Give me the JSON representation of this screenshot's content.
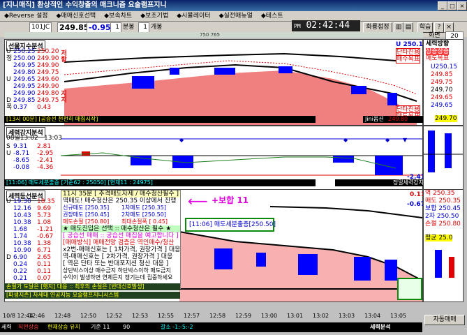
{
  "window": {
    "title": "[지니매직] 환상적인 수익창출의 매크니즘 요술램프지니"
  },
  "menu": [
    "◆Reverse 설정",
    "◆매매신호선택",
    "◆보속차트",
    "◆보조기법",
    "◆시뮬레이터",
    "◆실전매뉴얼",
    "◆테스트"
  ],
  "toolbar": {
    "code": "101JC",
    "price": "249.85",
    "change": "-0.95",
    "period": "1",
    "period_unit": "분봉",
    "count": "1",
    "count_unit": "개봉",
    "clock_prefix": "PM",
    "clock": "02:42:44",
    "right_btn1": "화룡점정",
    "right_btn2": "학습",
    "right_btn3": "?",
    "screen_label": "화면",
    "screen_no": "20",
    "num_label": "750 765"
  },
  "panel1": {
    "title": "선물지수분석",
    "rows": [
      {
        "k": "U",
        "a": "250.25",
        "b": "250.20"
      },
      {
        "k": "정",
        "a": "250.00",
        "b": "249.90"
      },
      {
        "k": "",
        "a": "249.95",
        "b": "249.90"
      },
      {
        "k": "",
        "a": "249.80",
        "b": "249.75"
      },
      {
        "k": "U",
        "a": "249.65",
        "b": "249.60"
      },
      {
        "k": "",
        "a": "249.95",
        "b": "249.90"
      },
      {
        "k": "",
        "a": "249.90",
        "b": "249.80"
      },
      {
        "k": "D",
        "a": "249.85",
        "b": "249.75"
      },
      {
        "k": "폭",
        "a": "0.37",
        "b": "0.43"
      }
    ],
    "side_label1": "저항",
    "side_label2": "지지",
    "footer": "[13시 00분] [공습선 천천히 매집시작]",
    "footer_right": "Jini옵션",
    "footer_price": "249.80",
    "tag1": "단타진용",
    "tag2": "매도목표"
  },
  "right1": {
    "title": "세력방향",
    "sub": "상승상승",
    "tag": "매도목표",
    "labels": [
      "U250.15",
      "249.85",
      "249.75",
      "249.70",
      "249.65",
      "249.65"
    ],
    "price": "249.70",
    "top_price": "U 250.15",
    "top_tag1": "단타진용",
    "top_tag2": "매수목표"
  },
  "panel2": {
    "title": "세력강지분석",
    "time": "08일13:02",
    "time2": "13:03",
    "rows": [
      {
        "k": "S",
        "a": "9.31",
        "b": "2.81"
      },
      {
        "k": "U",
        "a": "-8.71",
        "b": "-2.95"
      },
      {
        "k": "",
        "a": "-8.65",
        "b": "-2.41"
      },
      {
        "k": "",
        "a": "-0.08",
        "b": "-4.36"
      }
    ],
    "footer": "[11:06] 매도세분출증 [기준62 : 25050] [현재11 : 24975]",
    "footer_right": "정밀세력강지",
    "value": "-2.41"
  },
  "panel3": {
    "title": "세력등선분석",
    "rows": [
      {
        "k": "U",
        "a": "19.30",
        "b": "18.35"
      },
      {
        "k": "",
        "a": "12.16",
        "b": "9.69"
      },
      {
        "k": "",
        "a": "10.43",
        "b": "5.73"
      },
      {
        "k": "",
        "a": "10.38",
        "b": "1.08"
      },
      {
        "k": "",
        "a": "1.68",
        "b": "-1.21"
      },
      {
        "k": "",
        "a": "1.74",
        "b": "-0.67"
      },
      {
        "k": "",
        "a": "10.38",
        "b": "1.38"
      },
      {
        "k": "",
        "a": "10.90",
        "b": "6.71"
      },
      {
        "k": "D",
        "a": "6.90",
        "b": "2.65"
      },
      {
        "k": "",
        "a": "0.24",
        "b": "0.11"
      },
      {
        "k": "",
        "a": "0.22",
        "b": "0.11"
      },
      {
        "k": "",
        "a": "0.21",
        "b": "0.07"
      }
    ],
    "footer1": "손절가 도달은 [햇지] 대응 :: 최후의 손절은 [반대신호발생]",
    "footer2": "[파생지존] 차세대 연공지능 요술램프지니시스템",
    "value1": "0.11",
    "value2": "-0.67"
  },
  "infobox": {
    "head": "11시 35분 [ 추격매도자제 / 매수청산필수 ]",
    "line1": "역매도! 매수청산은 250.35 이상에서 진행",
    "rows": [
      {
        "l": "신규매도 [250.35]",
        "r": "1차매도 [250.35]"
      },
      {
        "l": "권장매도 [250.45]",
        "r": "2차매도 [250.50]"
      },
      {
        "l": "매도손절 [250.80]",
        "r": "최대손절폭 [ 0.45]"
      }
    ],
    "line2": "★ 매도진입은 선택 :: 매수청산은 필수 ★",
    "line3": "[ 공습선 매매 :: 공습선 매집을 예고합니다 ]",
    "line4": "[매매방식] 매매전망 검증은 역인매수/청산",
    "line5": "x2번-매매신호는 [ 1차가격, 권장가격 ] 대응",
    "line6": "역-매매신호는 [ 2차가격, 권장가격 ] 대응",
    "line7": "[ 역은 단타 또는 반대포지션 청산 대응 ]",
    "line8": "상단박스이상 매수금지 하단박스이하 매도금지",
    "line9": "수익이 발생하면 연체든지 챙기는데 집중하세요"
  },
  "overlay": {
    "arrow_text": "+보합 11",
    "box_text": "[11:06] 매도세분출증[250.50]"
  },
  "right3": {
    "labels": [
      "역 250.35",
      "매도 250.35",
      "보합 250.45",
      "2차 250.50",
      "손절 250.80"
    ],
    "tag": "평균",
    "tag_value": "25.0"
  },
  "timeaxis": [
    "10/8 12:44",
    "12:46",
    "12:48",
    "12:50",
    "12:52",
    "12:53",
    "12:55",
    "12:57",
    "12:58",
    "12:59",
    "13:00",
    "13:01",
    "13:02",
    "13:03",
    "13:04",
    "13:05"
  ],
  "status": {
    "l1": "세력",
    "l2": "직전상승",
    "l3": "현재상승 유지",
    "l4": "기준 11",
    "l5": "90",
    "l6": "갈소 -1:-5:-2",
    "right": "세력분석",
    "btn": "자동매매"
  },
  "colors": {
    "title": "#0a246a",
    "up": "#e00000",
    "down": "#0000d0",
    "fill": "#f08080"
  }
}
